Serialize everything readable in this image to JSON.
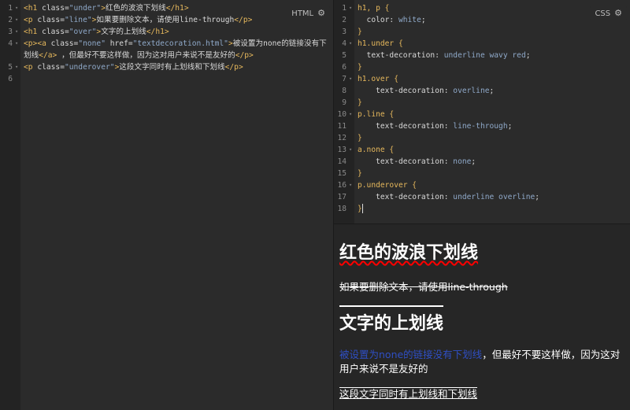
{
  "html_editor": {
    "badge": "HTML",
    "lines": [
      {
        "num": "1",
        "foldable": true,
        "tokens": [
          [
            "tag",
            "<h1 "
          ],
          [
            "attr",
            "class="
          ],
          [
            "val",
            "\"under\""
          ],
          [
            "tag",
            ">"
          ],
          [
            "txt",
            "红色的波浪下划线"
          ],
          [
            "tag",
            "</h1>"
          ]
        ]
      },
      {
        "num": "2",
        "foldable": true,
        "tokens": [
          [
            "tag",
            "<p "
          ],
          [
            "attr",
            "class="
          ],
          [
            "val",
            "\"line\""
          ],
          [
            "tag",
            ">"
          ],
          [
            "txt",
            "如果要删除文本，请使用line-through"
          ],
          [
            "tag",
            "</p>"
          ]
        ]
      },
      {
        "num": "3",
        "foldable": true,
        "tokens": [
          [
            "tag",
            "<h1 "
          ],
          [
            "attr",
            "class="
          ],
          [
            "val",
            "\"over\""
          ],
          [
            "tag",
            ">"
          ],
          [
            "txt",
            "文字的上划线"
          ],
          [
            "tag",
            "</h1>"
          ]
        ]
      },
      {
        "num": "4",
        "foldable": true,
        "wrap": true,
        "tokens": [
          [
            "tag",
            "<p><a "
          ],
          [
            "attr",
            "class="
          ],
          [
            "val",
            "\"none\" "
          ],
          [
            "attr",
            "href="
          ],
          [
            "val",
            "\"textdecoration.html\""
          ],
          [
            "tag",
            ">"
          ],
          [
            "txt",
            "被设置为none的链接没有下划线"
          ],
          [
            "tag",
            "</a>"
          ],
          [
            "txt",
            " ，但最好不要这样做，因为这对用户来说不是友好的"
          ],
          [
            "tag",
            "</p>"
          ]
        ]
      },
      {
        "num": "5",
        "foldable": true,
        "tokens": [
          [
            "tag",
            "<p "
          ],
          [
            "attr",
            "class="
          ],
          [
            "val",
            "\"underover\""
          ],
          [
            "tag",
            ">"
          ],
          [
            "txt",
            "这段文字同时有上划线和下划线"
          ],
          [
            "tag",
            "</p>"
          ]
        ]
      },
      {
        "num": "6",
        "foldable": false,
        "tokens": []
      }
    ]
  },
  "css_editor": {
    "badge": "CSS",
    "lines": [
      {
        "num": "1",
        "foldable": true,
        "tokens": [
          [
            "sel",
            "h1, p {"
          ]
        ]
      },
      {
        "num": "2",
        "foldable": false,
        "tokens": [
          [
            "prop",
            "  color: "
          ],
          [
            "pv",
            "white"
          ],
          [
            "prop",
            ";"
          ]
        ]
      },
      {
        "num": "3",
        "foldable": false,
        "tokens": [
          [
            "sel",
            "}"
          ]
        ]
      },
      {
        "num": "4",
        "foldable": true,
        "tokens": [
          [
            "sel",
            "h1.under {"
          ]
        ]
      },
      {
        "num": "5",
        "foldable": false,
        "tokens": [
          [
            "prop",
            "  text-decoration: "
          ],
          [
            "pv",
            "underline wavy red"
          ],
          [
            "prop",
            ";"
          ]
        ]
      },
      {
        "num": "6",
        "foldable": false,
        "tokens": [
          [
            "sel",
            "}"
          ]
        ]
      },
      {
        "num": "7",
        "foldable": true,
        "tokens": [
          [
            "sel",
            "h1.over {"
          ]
        ]
      },
      {
        "num": "8",
        "foldable": false,
        "tokens": [
          [
            "prop",
            "    text-decoration: "
          ],
          [
            "pv",
            "overline"
          ],
          [
            "prop",
            ";"
          ]
        ]
      },
      {
        "num": "9",
        "foldable": false,
        "tokens": [
          [
            "sel",
            "}"
          ]
        ]
      },
      {
        "num": "10",
        "foldable": true,
        "tokens": [
          [
            "sel",
            "p.line {"
          ]
        ]
      },
      {
        "num": "11",
        "foldable": false,
        "tokens": [
          [
            "prop",
            "    text-decoration: "
          ],
          [
            "pv",
            "line-through"
          ],
          [
            "prop",
            ";"
          ]
        ]
      },
      {
        "num": "12",
        "foldable": false,
        "tokens": [
          [
            "sel",
            "}"
          ]
        ]
      },
      {
        "num": "13",
        "foldable": true,
        "tokens": [
          [
            "sel",
            "a.none {"
          ]
        ]
      },
      {
        "num": "14",
        "foldable": false,
        "tokens": [
          [
            "prop",
            "    text-decoration: "
          ],
          [
            "pv",
            "none"
          ],
          [
            "prop",
            ";"
          ]
        ]
      },
      {
        "num": "15",
        "foldable": false,
        "tokens": [
          [
            "sel",
            "}"
          ]
        ]
      },
      {
        "num": "16",
        "foldable": true,
        "tokens": [
          [
            "sel",
            "p.underover {"
          ]
        ]
      },
      {
        "num": "17",
        "foldable": false,
        "tokens": [
          [
            "prop",
            "    text-decoration: "
          ],
          [
            "pv",
            "underline overline"
          ],
          [
            "prop",
            ";"
          ]
        ]
      },
      {
        "num": "18",
        "foldable": false,
        "tokens": [
          [
            "sel",
            "}"
          ]
        ]
      }
    ]
  },
  "preview": {
    "h1_under": "红色的波浪下划线",
    "p_line": "如果要删除文本，请使用line-through",
    "h1_over": "文字的上划线",
    "p_none_link": "被设置为none的链接没有下划线",
    "p_none_rest": "，但最好不要这样做，因为这对用户来说不是友好的",
    "p_underover": "这段文字同时有上划线和下划线"
  },
  "icons": {
    "badge_icon": "settings-refresh-icon"
  },
  "colors": {
    "tag": "#e6b85c",
    "attr_value": "#8fa9c9",
    "link": "#2f4fc4",
    "wavy_underline": "#ff0000"
  }
}
